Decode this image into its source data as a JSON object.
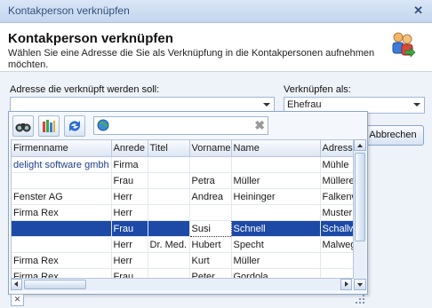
{
  "window": {
    "title": "Kontakperson verknüpfen"
  },
  "header": {
    "heading": "Kontakperson verknüpfen",
    "description": "Wählen Sie eine Adresse die Sie als Verknüpfung in die Kontakpersonen aufnehmen möchten."
  },
  "form": {
    "address_label": "Adresse die verknüpft werden soll:",
    "address_value": "",
    "link_label": "Verknüpfen als:",
    "link_value": "Ehefrau",
    "cancel_label": "Abbrechen"
  },
  "grid": {
    "columns": [
      "Firmenname",
      "Anrede",
      "Titel",
      "Vorname",
      "Name",
      "Adresse"
    ],
    "rows": [
      [
        "delight software gmbh",
        "Firma",
        "",
        "",
        "",
        "Mühle"
      ],
      [
        "",
        "Frau",
        "",
        "Petra",
        "Müller",
        "Müllere"
      ],
      [
        "Fenster AG",
        "Herr",
        "",
        "Andrea",
        "Heininger",
        "Falkenw"
      ],
      [
        "Firma Rex",
        "Herr",
        "",
        "",
        "",
        "Muster"
      ],
      [
        "",
        "Frau",
        "",
        "Susi",
        "Schnell",
        "Schallw"
      ],
      [
        "",
        "Herr",
        "Dr. Med.",
        "Hubert",
        "Specht",
        "Malweg"
      ],
      [
        "Firma Rex",
        "Herr",
        "",
        "Kurt",
        "Müller",
        ""
      ],
      [
        "Firma Rex",
        "Frau",
        "",
        "Peter",
        "Gordola",
        ""
      ]
    ],
    "selected_row": 4
  },
  "icons": [
    "binoculars-icon",
    "columns-icon",
    "refresh-icon",
    "globe-icon",
    "clear-icon",
    "people-icon"
  ],
  "colors": {
    "selection": "#1c4aa6",
    "title_text": "#33507a"
  }
}
